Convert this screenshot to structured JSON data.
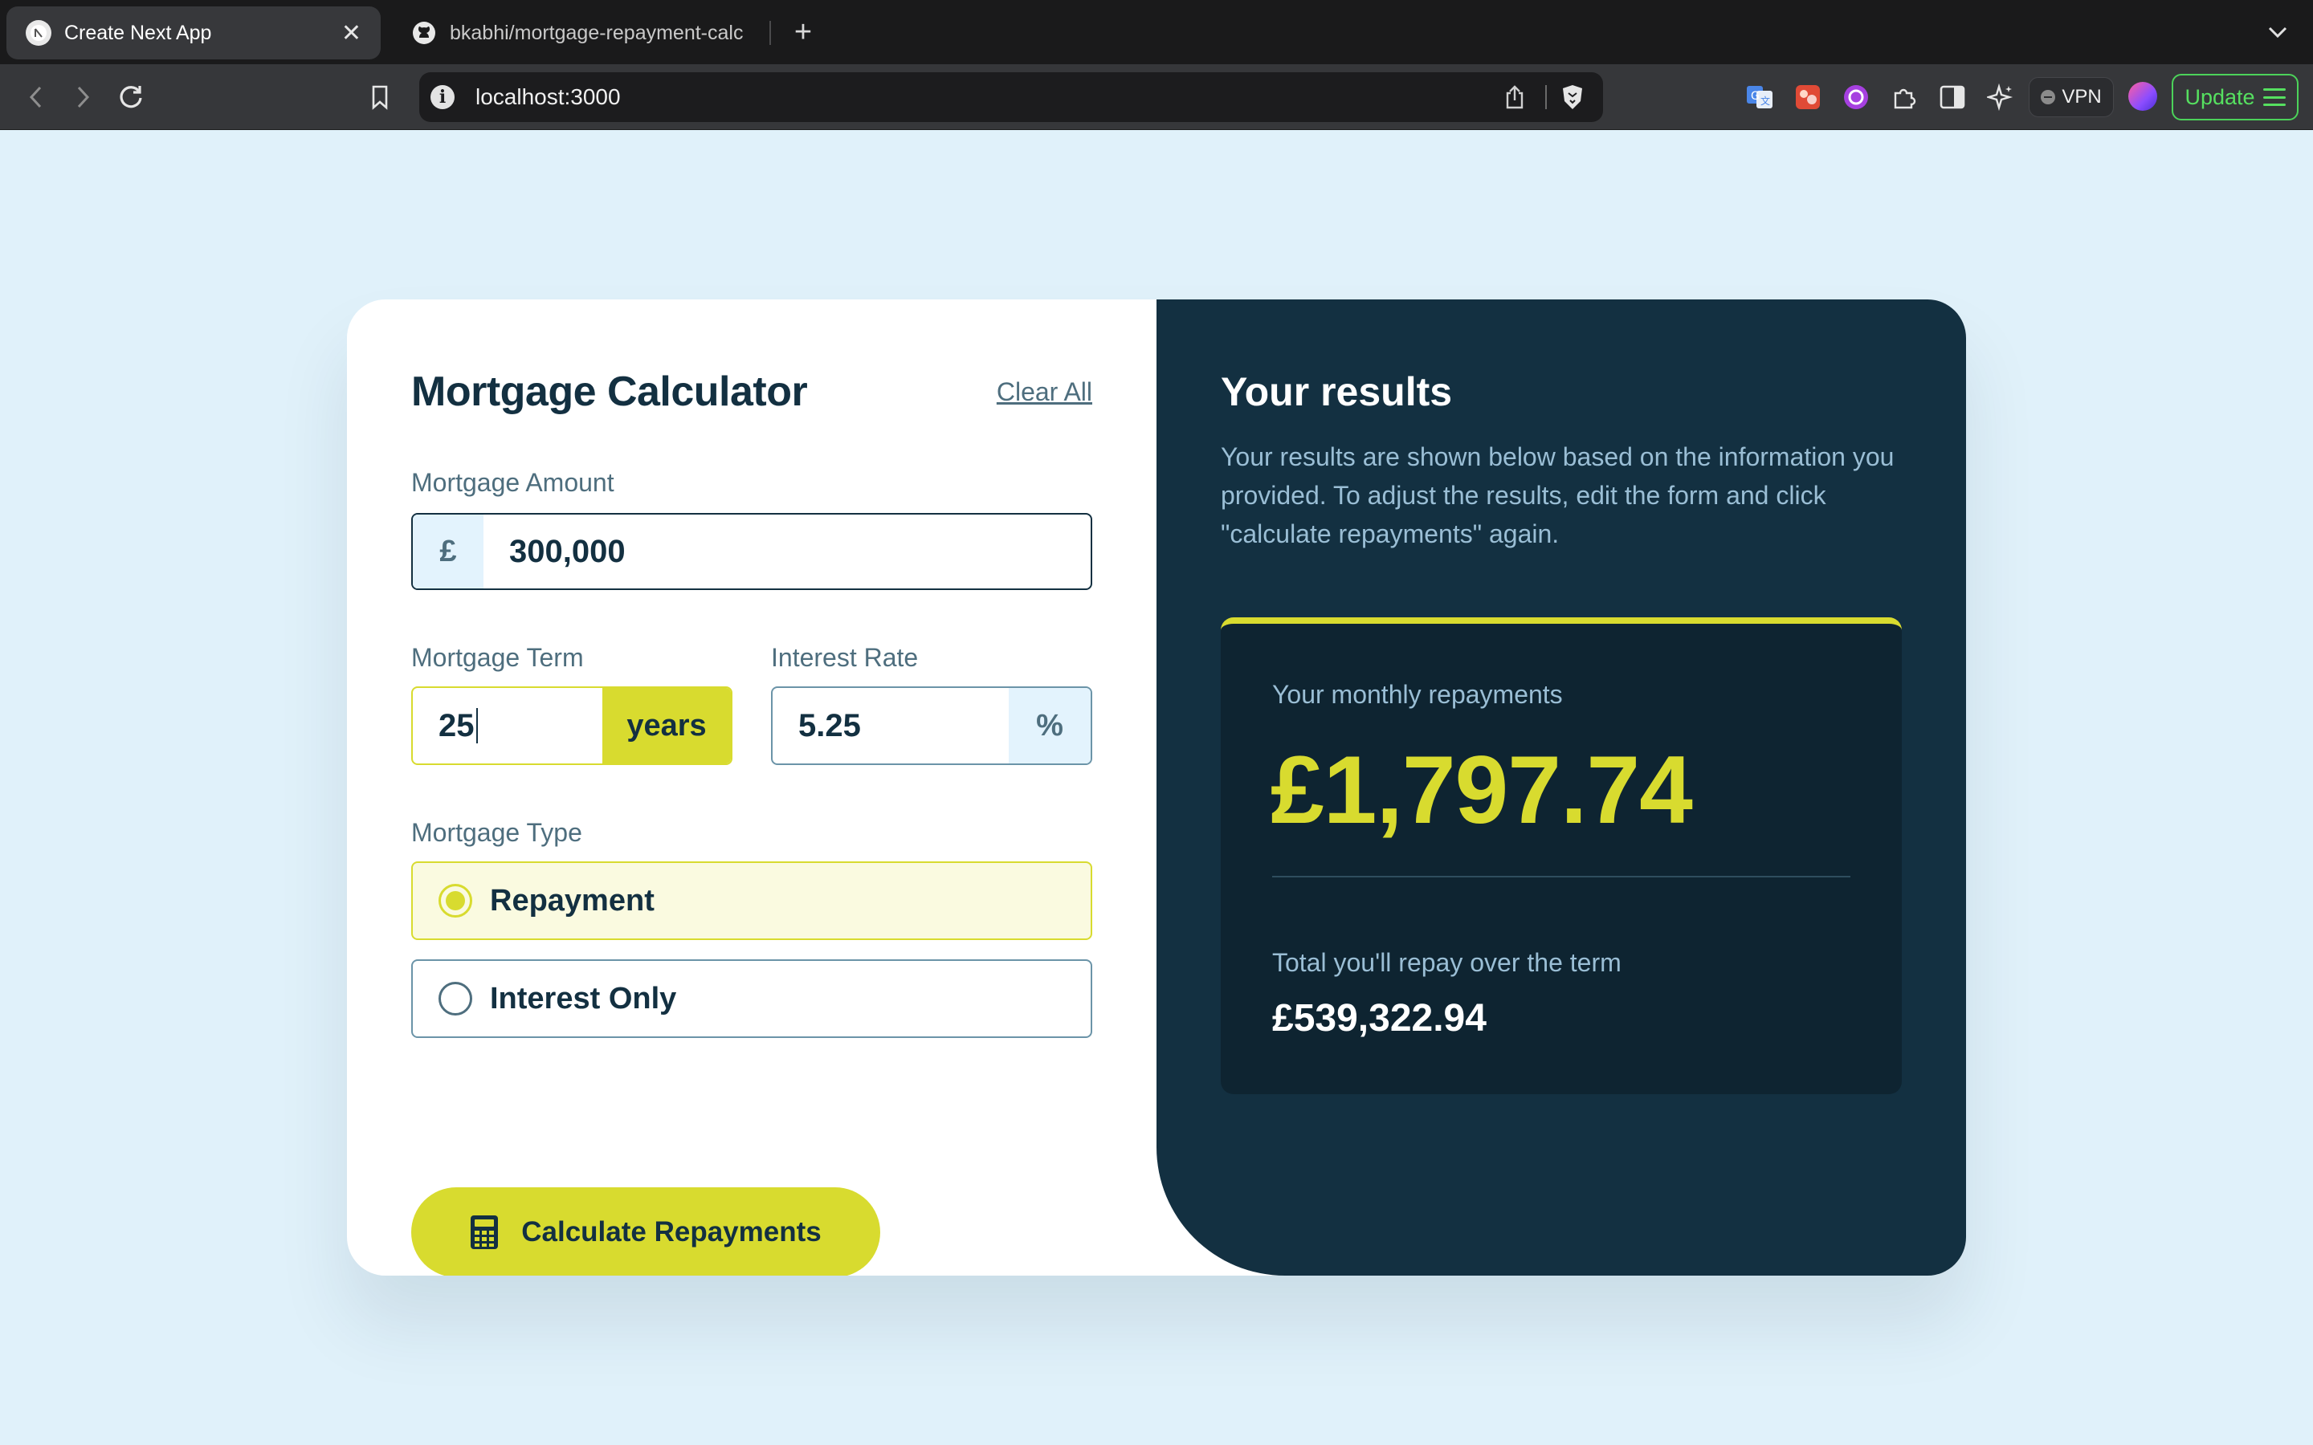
{
  "browser": {
    "tabs": [
      {
        "title": "Create Next App",
        "active": true
      },
      {
        "title": "bkabhi/mortgage-repayment-calc",
        "active": false
      }
    ],
    "url": "localhost:3000",
    "vpn_label": "VPN",
    "update_label": "Update"
  },
  "calculator": {
    "title": "Mortgage Calculator",
    "clear_all": "Clear All",
    "amount": {
      "label": "Mortgage Amount",
      "prefix": "£",
      "value": "300,000"
    },
    "term": {
      "label": "Mortgage Term",
      "value": "25",
      "suffix": "years"
    },
    "rate": {
      "label": "Interest Rate",
      "value": "5.25",
      "suffix": "%"
    },
    "type": {
      "label": "Mortgage Type",
      "options": [
        {
          "label": "Repayment",
          "selected": true
        },
        {
          "label": "Interest Only",
          "selected": false
        }
      ]
    },
    "submit_label": "Calculate Repayments"
  },
  "results": {
    "title": "Your results",
    "description": "Your results are shown below based on the information you provided. To adjust the results, edit the form and click \"calculate repayments\" again.",
    "monthly_label": "Your monthly repayments",
    "monthly_value": "£1,797.74",
    "total_label": "Total you'll repay over the term",
    "total_value": "£539,322.94"
  },
  "colors": {
    "accent_lime": "#d8db2f",
    "slate_900": "#133041",
    "page_bg": "#e0f1fa"
  }
}
